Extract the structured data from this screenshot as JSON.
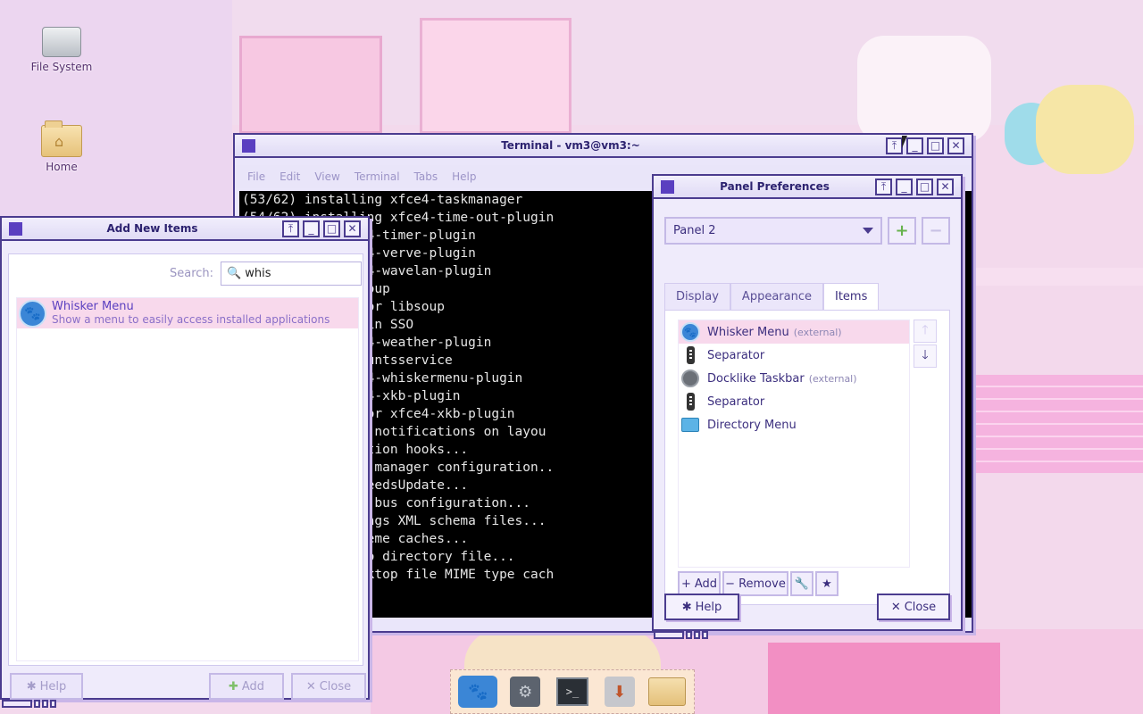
{
  "desktop": {
    "icons": [
      {
        "label": "File System"
      },
      {
        "label": "Home"
      }
    ]
  },
  "terminal": {
    "title": "Terminal - vm3@vm3:~",
    "menu": [
      "File",
      "Edit",
      "View",
      "Terminal",
      "Tabs",
      "Help"
    ],
    "lines": [
      "(53/62) installing xfce4-taskmanager",
      "(54/62) installing xfce4-time-out-plugin",
      "        ing xfce4-timer-plugin",
      "        ing xfce4-verve-plugin",
      "        ing xfce4-wavelan-plugin",
      "        ing libsoup",
      "        encies for libsoup",
      "        ows Domain SSO",
      "        ing xfce4-weather-plugin",
      "        ing accountsservice",
      "        ing xfce4-whiskermenu-plugin",
      "        ing xfce4-xkb-plugin",
      "        encies for xfce4-xkb-plugin",
      "        yd: show notifications on layou",
      "        -transaction hooks...",
      "          system manager configuration..",
      "        nditionNeedsUpdate...",
      "          system bus configuration...",
      "          GSettings XML schema files...",
      "         icon theme caches...",
      "         the info directory file...",
      "         the desktop file MIME type cach"
    ]
  },
  "add_items": {
    "title": "Add New Items",
    "search_label": "Search:",
    "search_value": "whis",
    "results": [
      {
        "name": "Whisker Menu",
        "description": "Show a menu to easily access installed applications"
      }
    ],
    "help_label": "Help",
    "add_label": "Add",
    "close_label": "Close"
  },
  "panel_prefs": {
    "title": "Panel Preferences",
    "panel_selected": "Panel 2",
    "tabs": [
      "Display",
      "Appearance",
      "Items"
    ],
    "selected_tab": "Items",
    "items": [
      {
        "label": "Whisker Menu",
        "suffix": "(external)",
        "icon": "whisker-icon"
      },
      {
        "label": "Separator",
        "suffix": "",
        "icon": "separator-icon"
      },
      {
        "label": "Docklike Taskbar",
        "suffix": "(external)",
        "icon": "docklike-icon"
      },
      {
        "label": "Separator",
        "suffix": "",
        "icon": "separator-icon"
      },
      {
        "label": "Directory Menu",
        "suffix": "",
        "icon": "folder-icon"
      }
    ],
    "add_label": "Add",
    "remove_label": "Remove",
    "help_label": "Help",
    "close_label": "Close"
  },
  "colors": {
    "accent": "#5a3fc0",
    "border": "#4b3c8f",
    "selection": "#f8d9ec"
  }
}
